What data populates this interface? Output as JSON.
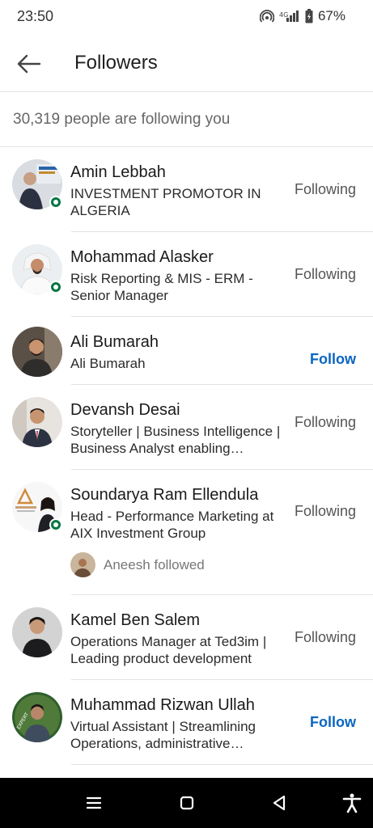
{
  "status_bar": {
    "time": "23:50",
    "battery": "67%"
  },
  "header": {
    "title": "Followers"
  },
  "summary": "30,319 people are following you",
  "followers": [
    {
      "name": "Amin Lebbah",
      "headline": "INVESTMENT PROMOTOR IN ALGERIA",
      "action": "Following"
    },
    {
      "name": "Mohammad Alasker",
      "headline": "Risk Reporting & MIS - ERM - Senior Manager",
      "action": "Following"
    },
    {
      "name": "Ali Bumarah",
      "headline": "Ali Bumarah",
      "action": "Follow"
    },
    {
      "name": "Devansh Desai",
      "headline": "Storyteller | Business Intelligence | Business Analyst enabling Business Growth",
      "action": "Following"
    },
    {
      "name": "Soundarya Ram Ellendula",
      "headline": "Head - Performance Marketing at AIX Investment Group",
      "action": "Following",
      "mutual": "Aneesh followed"
    },
    {
      "name": "Kamel Ben Salem",
      "headline": "Operations Manager at Ted3im | Leading product development",
      "action": "Following"
    },
    {
      "name": "Muhammad Rizwan Ullah",
      "headline": "Virtual Assistant | Streamlining Operations, administrative assistance",
      "action": "Follow"
    }
  ],
  "colors": {
    "accent": "#0a66c2",
    "online": "#057642",
    "text_secondary": "#666666"
  },
  "icons": {
    "back": "arrow-left-icon",
    "menu": "menu-icon",
    "home": "square-home-icon",
    "back_nav": "triangle-back-icon",
    "accessibility": "accessibility-icon"
  }
}
